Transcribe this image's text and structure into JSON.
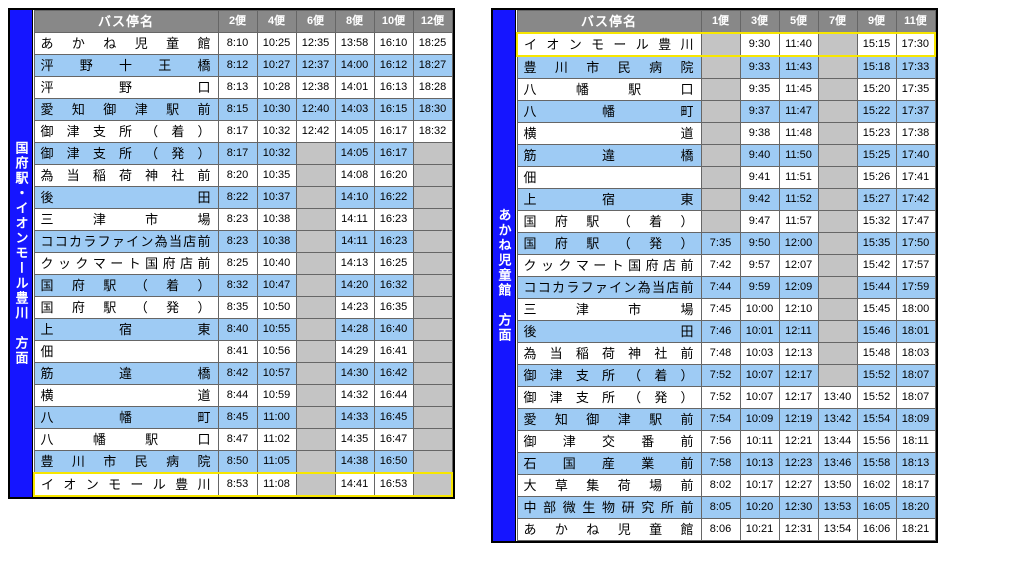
{
  "left": {
    "direction": "国府駅・イオンモール豊川　方面",
    "header_stop": "バス停名",
    "cols": [
      "2便",
      "4便",
      "6便",
      "8便",
      "10便",
      "12便"
    ],
    "highlight_index": 19,
    "rows": [
      {
        "stop": "あかね児童館",
        "t": [
          "8:10",
          "10:25",
          "12:35",
          "13:58",
          "16:10",
          "18:25"
        ],
        "alt": false
      },
      {
        "stop": "泙野十王橋",
        "t": [
          "8:12",
          "10:27",
          "12:37",
          "14:00",
          "16:12",
          "18:27"
        ],
        "alt": true
      },
      {
        "stop": "泙野口",
        "t": [
          "8:13",
          "10:28",
          "12:38",
          "14:01",
          "16:13",
          "18:28"
        ],
        "alt": false
      },
      {
        "stop": "愛知御津駅前",
        "t": [
          "8:15",
          "10:30",
          "12:40",
          "14:03",
          "16:15",
          "18:30"
        ],
        "alt": true
      },
      {
        "stop": "御津支所（着）",
        "t": [
          "8:17",
          "10:32",
          "12:42",
          "14:05",
          "16:17",
          "18:32"
        ],
        "alt": false
      },
      {
        "stop": "御津支所（発）",
        "t": [
          "8:17",
          "10:32",
          "",
          "14:05",
          "16:17",
          ""
        ],
        "alt": true
      },
      {
        "stop": "為当稲荷神社前",
        "t": [
          "8:20",
          "10:35",
          "",
          "14:08",
          "16:20",
          ""
        ],
        "alt": false
      },
      {
        "stop": "後田",
        "t": [
          "8:22",
          "10:37",
          "",
          "14:10",
          "16:22",
          ""
        ],
        "alt": true
      },
      {
        "stop": "三津市場",
        "t": [
          "8:23",
          "10:38",
          "",
          "14:11",
          "16:23",
          ""
        ],
        "alt": false
      },
      {
        "stop": "ココカラファイン為当店前",
        "t": [
          "8:23",
          "10:38",
          "",
          "14:11",
          "16:23",
          ""
        ],
        "alt": true
      },
      {
        "stop": "クックマート国府店前",
        "t": [
          "8:25",
          "10:40",
          "",
          "14:13",
          "16:25",
          ""
        ],
        "alt": false
      },
      {
        "stop": "国府駅（着）",
        "t": [
          "8:32",
          "10:47",
          "",
          "14:20",
          "16:32",
          ""
        ],
        "alt": true
      },
      {
        "stop": "国府駅（発）",
        "t": [
          "8:35",
          "10:50",
          "",
          "14:23",
          "16:35",
          ""
        ],
        "alt": false
      },
      {
        "stop": "上宿東",
        "t": [
          "8:40",
          "10:55",
          "",
          "14:28",
          "16:40",
          ""
        ],
        "alt": true
      },
      {
        "stop": "佃",
        "t": [
          "8:41",
          "10:56",
          "",
          "14:29",
          "16:41",
          ""
        ],
        "alt": false
      },
      {
        "stop": "筋違橋",
        "t": [
          "8:42",
          "10:57",
          "",
          "14:30",
          "16:42",
          ""
        ],
        "alt": true
      },
      {
        "stop": "横道",
        "t": [
          "8:44",
          "10:59",
          "",
          "14:32",
          "16:44",
          ""
        ],
        "alt": false
      },
      {
        "stop": "八幡町",
        "t": [
          "8:45",
          "11:00",
          "",
          "14:33",
          "16:45",
          ""
        ],
        "alt": true
      },
      {
        "stop": "八幡駅口",
        "t": [
          "8:47",
          "11:02",
          "",
          "14:35",
          "16:47",
          ""
        ],
        "alt": false
      },
      {
        "stop": "豊川市民病院",
        "t": [
          "8:50",
          "11:05",
          "",
          "14:38",
          "16:50",
          ""
        ],
        "alt": true
      },
      {
        "stop": "イオンモール豊川",
        "t": [
          "8:53",
          "11:08",
          "",
          "14:41",
          "16:53",
          ""
        ],
        "alt": false
      }
    ]
  },
  "right": {
    "direction": "あかね児童館　方面",
    "header_stop": "バス停名",
    "cols": [
      "1便",
      "3便",
      "5便",
      "7便",
      "9便",
      "11便"
    ],
    "highlight_index": 0,
    "rows": [
      {
        "stop": "イオンモール豊川",
        "t": [
          "",
          "9:30",
          "11:40",
          "",
          "15:15",
          "17:30"
        ],
        "alt": false
      },
      {
        "stop": "豊川市民病院",
        "t": [
          "",
          "9:33",
          "11:43",
          "",
          "15:18",
          "17:33"
        ],
        "alt": true
      },
      {
        "stop": "八幡駅口",
        "t": [
          "",
          "9:35",
          "11:45",
          "",
          "15:20",
          "17:35"
        ],
        "alt": false
      },
      {
        "stop": "八幡町",
        "t": [
          "",
          "9:37",
          "11:47",
          "",
          "15:22",
          "17:37"
        ],
        "alt": true
      },
      {
        "stop": "横道",
        "t": [
          "",
          "9:38",
          "11:48",
          "",
          "15:23",
          "17:38"
        ],
        "alt": false
      },
      {
        "stop": "筋違橋",
        "t": [
          "",
          "9:40",
          "11:50",
          "",
          "15:25",
          "17:40"
        ],
        "alt": true
      },
      {
        "stop": "佃",
        "t": [
          "",
          "9:41",
          "11:51",
          "",
          "15:26",
          "17:41"
        ],
        "alt": false
      },
      {
        "stop": "上宿東",
        "t": [
          "",
          "9:42",
          "11:52",
          "",
          "15:27",
          "17:42"
        ],
        "alt": true
      },
      {
        "stop": "国府駅（着）",
        "t": [
          "",
          "9:47",
          "11:57",
          "",
          "15:32",
          "17:47"
        ],
        "alt": false
      },
      {
        "stop": "国府駅（発）",
        "t": [
          "7:35",
          "9:50",
          "12:00",
          "",
          "15:35",
          "17:50"
        ],
        "alt": true
      },
      {
        "stop": "クックマート国府店前",
        "t": [
          "7:42",
          "9:57",
          "12:07",
          "",
          "15:42",
          "17:57"
        ],
        "alt": false
      },
      {
        "stop": "ココカラファイン為当店前",
        "t": [
          "7:44",
          "9:59",
          "12:09",
          "",
          "15:44",
          "17:59"
        ],
        "alt": true
      },
      {
        "stop": "三津市場",
        "t": [
          "7:45",
          "10:00",
          "12:10",
          "",
          "15:45",
          "18:00"
        ],
        "alt": false
      },
      {
        "stop": "後田",
        "t": [
          "7:46",
          "10:01",
          "12:11",
          "",
          "15:46",
          "18:01"
        ],
        "alt": true
      },
      {
        "stop": "為当稲荷神社前",
        "t": [
          "7:48",
          "10:03",
          "12:13",
          "",
          "15:48",
          "18:03"
        ],
        "alt": false
      },
      {
        "stop": "御津支所（着）",
        "t": [
          "7:52",
          "10:07",
          "12:17",
          "",
          "15:52",
          "18:07"
        ],
        "alt": true
      },
      {
        "stop": "御津支所（発）",
        "t": [
          "7:52",
          "10:07",
          "12:17",
          "13:40",
          "15:52",
          "18:07"
        ],
        "alt": false
      },
      {
        "stop": "愛知御津駅前",
        "t": [
          "7:54",
          "10:09",
          "12:19",
          "13:42",
          "15:54",
          "18:09"
        ],
        "alt": true
      },
      {
        "stop": "御津交番前",
        "t": [
          "7:56",
          "10:11",
          "12:21",
          "13:44",
          "15:56",
          "18:11"
        ],
        "alt": false
      },
      {
        "stop": "石国産業前",
        "t": [
          "7:58",
          "10:13",
          "12:23",
          "13:46",
          "15:58",
          "18:13"
        ],
        "alt": true
      },
      {
        "stop": "大草集荷場前",
        "t": [
          "8:02",
          "10:17",
          "12:27",
          "13:50",
          "16:02",
          "18:17"
        ],
        "alt": false
      },
      {
        "stop": "中部微生物研究所前",
        "t": [
          "8:05",
          "10:20",
          "12:30",
          "13:53",
          "16:05",
          "18:20"
        ],
        "alt": true
      },
      {
        "stop": "あかね児童館",
        "t": [
          "8:06",
          "10:21",
          "12:31",
          "13:54",
          "16:06",
          "18:21"
        ],
        "alt": false
      }
    ]
  }
}
